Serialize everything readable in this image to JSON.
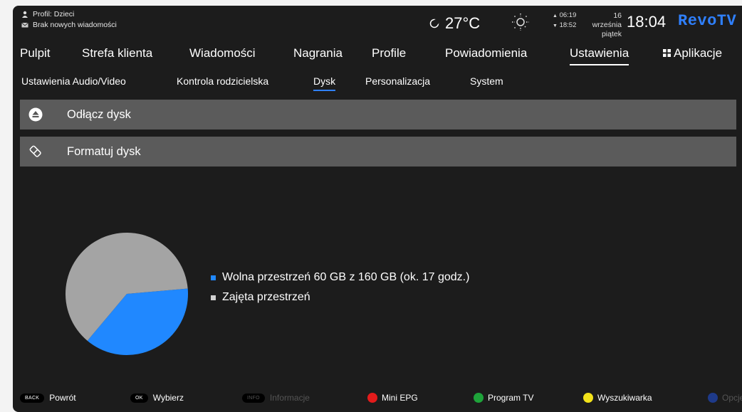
{
  "header": {
    "profile": "Profil: Dzieci",
    "messages": "Brak nowych wiadomości",
    "temperature": "27°C",
    "sunrise": "06:19",
    "sunset": "18:52",
    "date_line1": "16 września",
    "date_line2": "piątek",
    "time": "18:04",
    "brand": "RevoTV"
  },
  "nav": {
    "items": [
      "Pulpit",
      "Strefa klienta",
      "Wiadomości",
      "Nagrania",
      "Profile",
      "Powiadomienia",
      "Ustawienia",
      "Aplikacje"
    ],
    "active": "Ustawienia"
  },
  "subnav": {
    "items": [
      "Ustawienia Audio/Video",
      "Kontrola rodzicielska",
      "Dysk",
      "Personalizacja",
      "System"
    ],
    "active": "Dysk"
  },
  "actions": {
    "eject_label": "Odłącz dysk",
    "format_label": "Formatuj dysk"
  },
  "chart_data": {
    "type": "pie",
    "slices": [
      {
        "label": "Wolna przestrzeń 60 GB z 160 GB (ok. 17 godz.)",
        "value": 60,
        "color": "#2088ff"
      },
      {
        "label": "Zajęta przestrzeń",
        "value": 100,
        "color": "#a4a4a4"
      }
    ],
    "total": 160,
    "unit": "GB"
  },
  "footer": {
    "back_key": "BACK",
    "back_label": "Powrót",
    "ok_key": "OK",
    "ok_label": "Wybierz",
    "info_key": "INFO",
    "info_label": "Informacje",
    "red_label": "Mini EPG",
    "green_label": "Program TV",
    "yellow_label": "Wyszukiwarka",
    "blue_label": "Opcje",
    "colors": {
      "red": "#e31b1b",
      "green": "#1ea33a",
      "yellow": "#f2e21a",
      "blue": "#1e3a8a"
    }
  },
  "accent_color": "#2f80ff"
}
